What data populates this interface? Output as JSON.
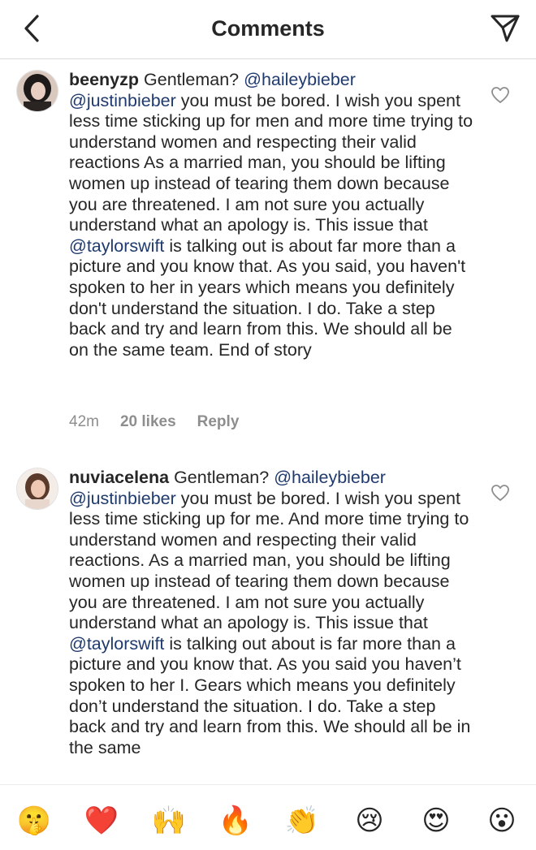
{
  "header": {
    "title": "Comments",
    "back_icon": "chevron-left-icon",
    "share_icon": "paper-plane-icon"
  },
  "comments": [
    {
      "username": "beenyzp",
      "pre": "Gentleman? ",
      "mention1": "@haileybieber",
      "mention2": "@justinbieber",
      "mid": " you must be bored. I wish you spent less time sticking up for men and more time trying to understand women and respecting their valid reactions As a married man, you should be lifting women up instead of tearing them down because you are threatened. I am not sure you actually understand what an apology is. This issue that ",
      "mention3": "@taylorswift",
      "post": " is talking out is about far more than a picture and you know that. As you said, you haven't spoken to her in years which means you definitely don't understand the situation. I do. Take a step back and try and learn from this. We should all be on the same team. End of story",
      "time": "42m",
      "likes": "20 likes",
      "reply": "Reply"
    },
    {
      "username": "nuviacelena",
      "pre": "Gentleman? ",
      "mention1": "@haileybieber",
      "mention2": "@justinbieber",
      "mid": " you must be bored. I wish you spent less time sticking up for me. And more time trying to understand women and respecting their valid reactions. As a married man, you should be lifting women up instead of tearing them down because you are threatened. I am not sure you actually understand what an apology is. This issue that ",
      "mention3": "@taylorswift",
      "post": " is talking out about is far more than a picture and you know that. As you said you haven’t spoken to her I. Gears which means you definitely don’t understand the situation. I do. Take a step back and try and learn from this. We should all be in the same"
    }
  ],
  "emoji_bar": [
    "🤫",
    "❤️",
    "🙌",
    "🔥",
    "👏",
    "😢",
    "😍",
    "😮"
  ],
  "colors": {
    "text": "#262626",
    "meta": "#8e8e8e",
    "mention": "#1e3a6e",
    "divider": "#dbdbdb"
  }
}
